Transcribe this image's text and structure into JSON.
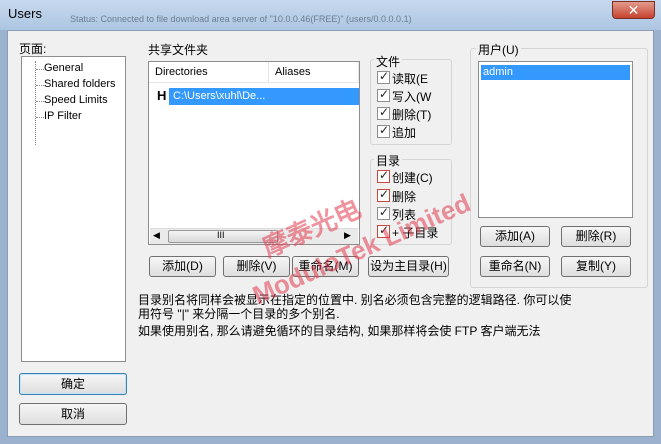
{
  "window": {
    "title": "Users",
    "bg_text": "Status: Connected to file download area server of \"10.0.0.46(FREE)\" (users/0.0.0.0.1)"
  },
  "nav": {
    "title": "页面:",
    "items": [
      "General",
      "Shared folders",
      "Speed Limits",
      "IP Filter"
    ]
  },
  "shared": {
    "title": "共享文件夹",
    "columns": [
      "Directories",
      "Aliases"
    ],
    "row_flag": "H",
    "row_path": "C:\\Users\\xuhl\\De...",
    "scroll_glyph": "III",
    "buttons": {
      "add": "添加(D)",
      "delete": "删除(V)",
      "rename": "重命名(M)",
      "set_home": "设为主目录(H)"
    }
  },
  "files": {
    "title": "文件",
    "read": "读取(E",
    "write": "写入(W",
    "delete": "删除(T)",
    "append": "追加"
  },
  "dirs": {
    "title": "目录",
    "create": "创建(C)",
    "delete": "删除",
    "list": "列表",
    "subdirs": "+ 子目录"
  },
  "users": {
    "title": "用户(U)",
    "items": [
      "admin"
    ],
    "buttons": {
      "add": "添加(A)",
      "delete": "删除(R)",
      "rename": "重命名(N)",
      "copy": "复制(Y)"
    }
  },
  "help": {
    "line1": "目录别名将同样会被显示在指定的位置中. 别名必须包含完整的逻辑路径. 你可以使",
    "line2": "用符号 \"|\" 来分隔一个目录的多个别名.",
    "line3": "如果使用别名, 那么请避免循环的目录结构, 如果那样将会使 FTP 客户端无法"
  },
  "dialog_buttons": {
    "ok": "确定",
    "cancel": "取消"
  },
  "watermark": {
    "line1": "摩泰光电",
    "line2": "ModuloTek Limited"
  },
  "colors": {
    "selection": "#3399ff",
    "watermark": "#e23c4e"
  }
}
